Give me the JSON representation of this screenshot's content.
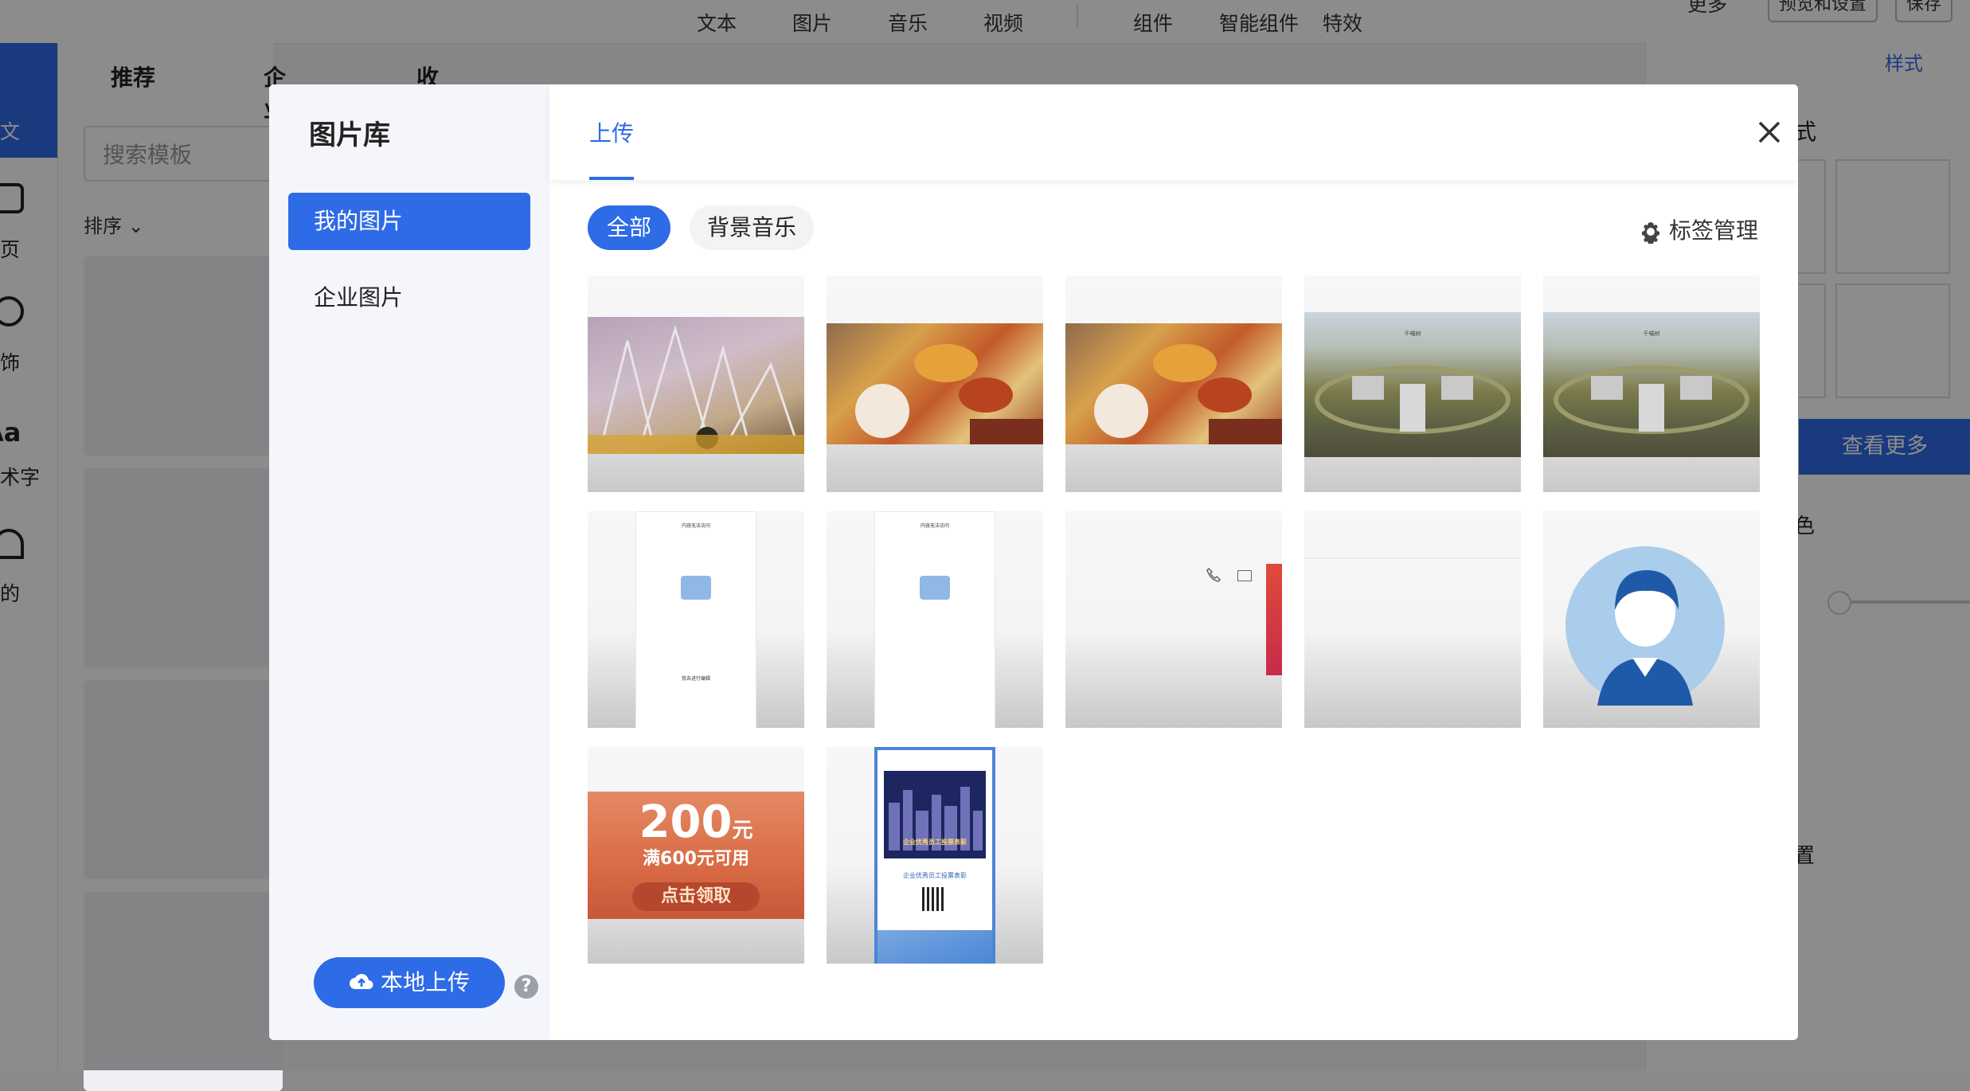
{
  "editor": {
    "topbar_items": [
      "文本",
      "图片",
      "音乐",
      "视频",
      "组件",
      "智能组件",
      "特效"
    ],
    "topbar_right": [
      "更多",
      "预览和设置",
      "保存"
    ],
    "rail_labels": [
      "文",
      "页",
      "饰",
      "术字",
      "的"
    ],
    "rail_aa": "Aa",
    "template_tabs": [
      "推荐",
      "企业",
      "收藏"
    ],
    "search_placeholder": "搜索模板",
    "sort_label": "排序",
    "right_tab": "样式",
    "right_more": "查看更多",
    "right_frag1": "式",
    "right_frag2": "色",
    "right_frag3": "置"
  },
  "modal": {
    "title": "图片库",
    "nav": [
      {
        "label": "我的图片",
        "active": true
      },
      {
        "label": "企业图片",
        "active": false
      }
    ],
    "header_tab": "上传",
    "filters": [
      {
        "label": "全部",
        "active": true
      },
      {
        "label": "背景音乐",
        "active": false
      }
    ],
    "tag_manage": "标签管理",
    "upload_button": "本地上传",
    "help_icon": "?"
  },
  "thumbnails": [
    {
      "name": "crown-photo"
    },
    {
      "name": "autumn-leaves-photo"
    },
    {
      "name": "autumn-leaves-photo-2"
    },
    {
      "name": "campus-aerial-photo",
      "caption": "千喵树"
    },
    {
      "name": "campus-aerial-photo-2",
      "caption": "千喵树"
    },
    {
      "name": "phone-screenshot",
      "screen_title": "内容无法访问",
      "footer": "我去进行编辑"
    },
    {
      "name": "phone-screenshot-2",
      "screen_title": "内容无法访问"
    },
    {
      "name": "call-ui-screenshot"
    },
    {
      "name": "blank-image"
    },
    {
      "name": "avatar-placeholder"
    },
    {
      "name": "coupon-banner",
      "amount": "200",
      "unit": "元",
      "condition": "满600元可用",
      "cta": "点击领取"
    },
    {
      "name": "vote-poster",
      "headline": "企业优秀员工投票表彰",
      "subline": "企业优秀员工投票表彰"
    }
  ],
  "colors": {
    "accent": "#2e6be6"
  }
}
